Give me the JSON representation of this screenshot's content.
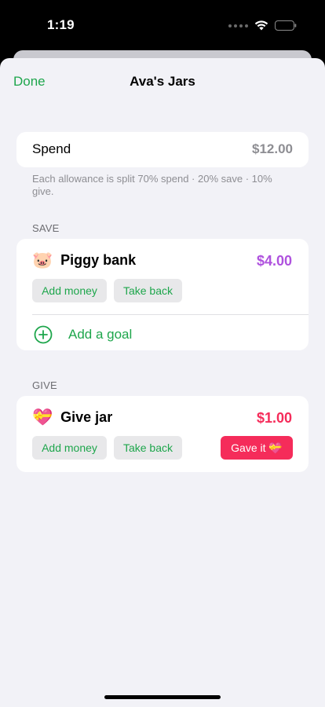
{
  "status": {
    "time": "1:19"
  },
  "nav": {
    "done_label": "Done",
    "title": "Ava's Jars"
  },
  "spend": {
    "label": "Spend",
    "amount": "$12.00"
  },
  "note": "Each allowance is split 70% spend · 20% save · 10% give.",
  "save_section": {
    "label": "SAVE",
    "jar": {
      "emoji": "🐷",
      "name": "Piggy bank",
      "amount": "$4.00",
      "amount_color": "#af52de"
    },
    "add_money_label": "Add money",
    "take_back_label": "Take back",
    "add_goal_label": "Add a goal"
  },
  "give_section": {
    "label": "GIVE",
    "jar": {
      "emoji": "💝",
      "name": "Give jar",
      "amount": "$1.00",
      "amount_color": "#f52c5a"
    },
    "add_money_label": "Add money",
    "take_back_label": "Take back",
    "gave_it_label": "Gave it 💝"
  },
  "colors": {
    "accent": "#1ea64c",
    "background": "#f2f2f7",
    "give": "#f52c5a",
    "save": "#af52de"
  }
}
